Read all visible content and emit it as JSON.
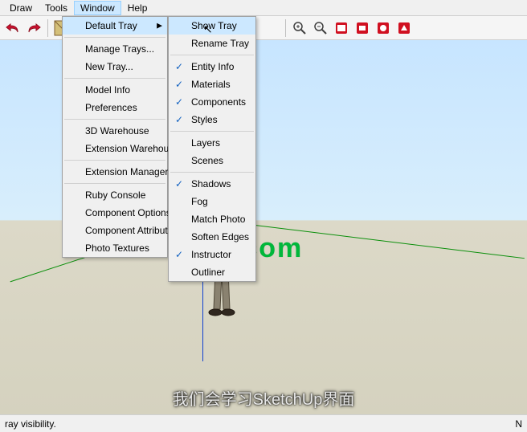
{
  "menubar": {
    "items": [
      "Draw",
      "Tools",
      "Window",
      "Help"
    ],
    "active_index": 2
  },
  "window_menu": {
    "items": [
      {
        "label": "Default Tray",
        "submenu": true,
        "highlight": true
      },
      {
        "sep": true
      },
      {
        "label": "Manage Trays..."
      },
      {
        "label": "New Tray..."
      },
      {
        "sep": true
      },
      {
        "label": "Model Info"
      },
      {
        "label": "Preferences"
      },
      {
        "sep": true
      },
      {
        "label": "3D Warehouse"
      },
      {
        "label": "Extension Warehouse"
      },
      {
        "sep": true
      },
      {
        "label": "Extension Manager"
      },
      {
        "sep": true
      },
      {
        "label": "Ruby Console"
      },
      {
        "label": "Component Options"
      },
      {
        "label": "Component Attributes"
      },
      {
        "label": "Photo Textures"
      }
    ]
  },
  "tray_submenu": {
    "items": [
      {
        "label": "Show Tray",
        "highlight": true
      },
      {
        "label": "Rename Tray"
      },
      {
        "sep": true
      },
      {
        "label": "Entity Info",
        "checked": true
      },
      {
        "label": "Materials",
        "checked": true
      },
      {
        "label": "Components",
        "checked": true
      },
      {
        "label": "Styles",
        "checked": true
      },
      {
        "sep": true
      },
      {
        "label": "Layers"
      },
      {
        "label": "Scenes"
      },
      {
        "sep": true
      },
      {
        "label": "Shadows",
        "checked": true
      },
      {
        "label": "Fog"
      },
      {
        "label": "Match Photo"
      },
      {
        "label": "Soften Edges"
      },
      {
        "label": "Instructor",
        "checked": true
      },
      {
        "label": "Outliner"
      }
    ]
  },
  "watermark": "www.cgtsj.com",
  "subtitle": "我们会学习SketchUp界面",
  "status": {
    "left": "ray visibility.",
    "right": "N"
  },
  "toolbar": {
    "icons": [
      "undo",
      "redo",
      "sep",
      "color-swatch",
      "sep",
      "sep",
      "sep",
      "sep",
      "zoom-in",
      "zoom-out",
      "pdf-red-1",
      "pdf-red-2",
      "pdf-red-3",
      "pdf-red-4"
    ]
  }
}
